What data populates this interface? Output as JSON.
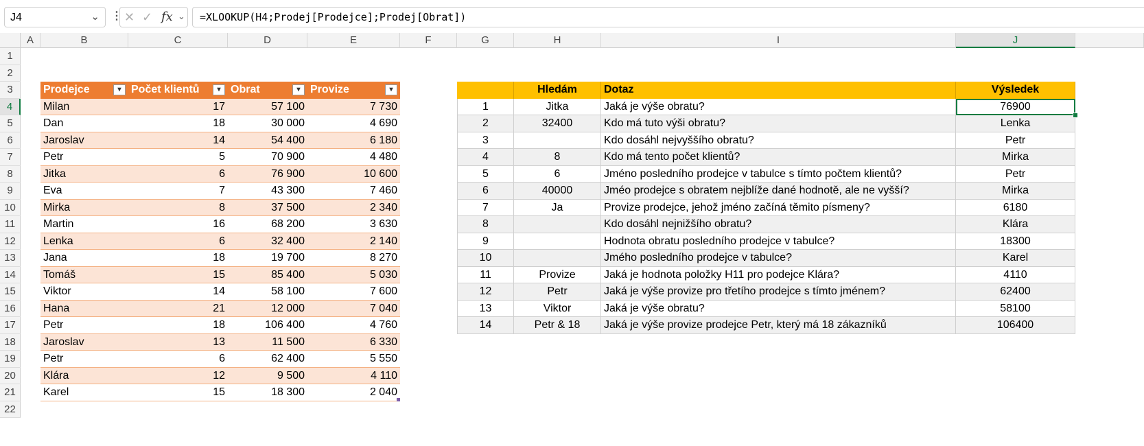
{
  "formula_bar": {
    "name_box": "J4",
    "formula": "=XLOOKUP(H4;Prodej[Prodejce];Prodej[Obrat])"
  },
  "columns": [
    "A",
    "B",
    "C",
    "D",
    "E",
    "F",
    "G",
    "H",
    "I",
    "J"
  ],
  "rows": [
    "1",
    "2",
    "3",
    "4",
    "5",
    "6",
    "7",
    "8",
    "9",
    "10",
    "11",
    "12",
    "13",
    "14",
    "15",
    "16",
    "17",
    "18",
    "19",
    "20",
    "21",
    "22"
  ],
  "selected": {
    "column": "J",
    "row": "4"
  },
  "left_table": {
    "headers": [
      "Prodejce",
      "Počet klientů",
      "Obrat",
      "Provize"
    ],
    "rows": [
      [
        "Milan",
        "17",
        "57 100",
        "7 730"
      ],
      [
        "Dan",
        "18",
        "30 000",
        "4 690"
      ],
      [
        "Jaroslav",
        "14",
        "54 400",
        "6 180"
      ],
      [
        "Petr",
        "5",
        "70 900",
        "4 480"
      ],
      [
        "Jitka",
        "6",
        "76 900",
        "10 600"
      ],
      [
        "Eva",
        "7",
        "43 300",
        "7 460"
      ],
      [
        "Mirka",
        "8",
        "37 500",
        "2 340"
      ],
      [
        "Martin",
        "16",
        "68 200",
        "3 630"
      ],
      [
        "Lenka",
        "6",
        "32 400",
        "2 140"
      ],
      [
        "Jana",
        "18",
        "19 700",
        "8 270"
      ],
      [
        "Tomáš",
        "15",
        "85 400",
        "5 030"
      ],
      [
        "Viktor",
        "14",
        "58 100",
        "7 600"
      ],
      [
        "Hana",
        "21",
        "12 000",
        "7 040"
      ],
      [
        "Petr",
        "18",
        "106 400",
        "4 760"
      ],
      [
        "Jaroslav",
        "13",
        "11 500",
        "6 330"
      ],
      [
        "Petr",
        "6",
        "62 400",
        "5 550"
      ],
      [
        "Klára",
        "12",
        "9 500",
        "4 110"
      ],
      [
        "Karel",
        "15",
        "18 300",
        "2 040"
      ]
    ],
    "colors": {
      "header": "#ed7d31",
      "band": "#fce4d6"
    }
  },
  "right_table": {
    "headers": [
      "",
      "Hledám",
      "Dotaz",
      "Výsledek"
    ],
    "rows": [
      [
        "1",
        "Jitka",
        "Jaká je výše obratu?",
        "76900"
      ],
      [
        "2",
        "32400",
        "Kdo má tuto výši obratu?",
        "Lenka"
      ],
      [
        "3",
        "",
        "Kdo dosáhl nejvyššího obratu?",
        "Petr"
      ],
      [
        "4",
        "8",
        "Kdo má tento počet klientů?",
        "Mirka"
      ],
      [
        "5",
        "6",
        "Jméno posledního prodejce v tabulce s tímto počtem klientů?",
        "Petr"
      ],
      [
        "6",
        "40000",
        "Jméo prodejce s obratem nejblíže dané hodnotě, ale ne vyšší?",
        "Mirka"
      ],
      [
        "7",
        "Ja",
        "Provize prodejce, jehož jméno začíná těmito písmeny?",
        "6180"
      ],
      [
        "8",
        "",
        "Kdo dosáhl nejnižšího obratu?",
        "Klára"
      ],
      [
        "9",
        "",
        "Hodnota obratu posledního prodejce v tabulce?",
        "18300"
      ],
      [
        "10",
        "",
        "Jmého posledního prodejce v tabulce?",
        "Karel"
      ],
      [
        "11",
        "Provize",
        "Jaká je hodnota položky H11 pro podejce Klára?",
        "4110"
      ],
      [
        "12",
        "Petr",
        "Jaká je výše provize pro třetího prodejce s tímto jménem?",
        "62400"
      ],
      [
        "13",
        "Viktor",
        "Jaká je výše obratu?",
        "58100"
      ],
      [
        "14",
        "Petr & 18",
        "Jaká je výše provize prodejce Petr, který má 18 zákazníků",
        "106400"
      ]
    ],
    "colors": {
      "header": "#ffc000",
      "band": "#f0f0f0"
    }
  },
  "icons": [
    "chevron-down-icon",
    "more-options-icon",
    "cancel-icon",
    "enter-icon",
    "function-icon"
  ]
}
